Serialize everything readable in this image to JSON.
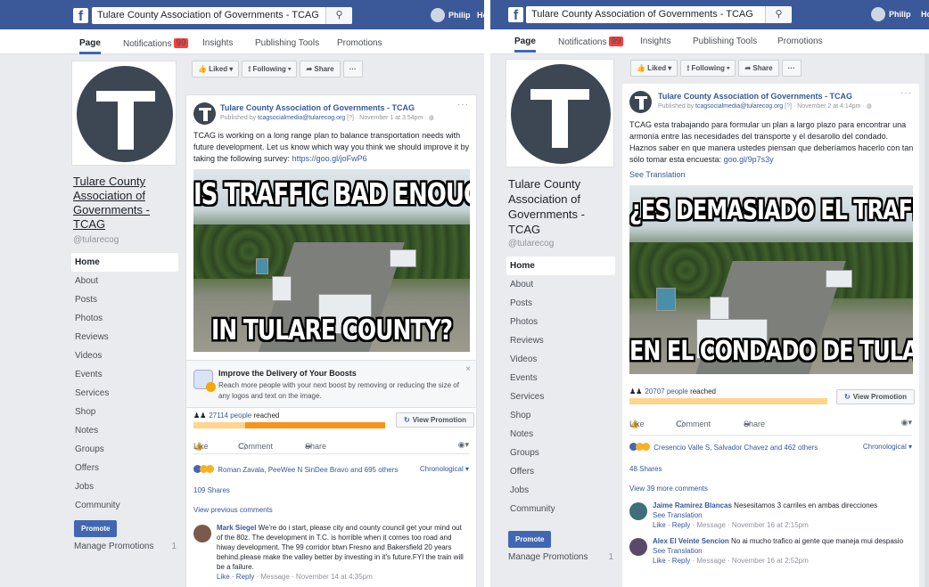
{
  "left": {
    "topbar": {
      "search": "Tulare County Association of Governments - TCAG",
      "search_icon": "search-icon",
      "user": "Philip",
      "extra": "Ho"
    },
    "subnav": {
      "page": "Page",
      "notifications": "Notifications",
      "notif_badge": "99",
      "insights": "Insights",
      "publishing": "Publishing Tools",
      "promotions": "Promotions"
    },
    "profile": {
      "name": "Tulare County Association of Governments - TCAG",
      "handle": "@tularecog"
    },
    "nav": [
      "Home",
      "About",
      "Posts",
      "Photos",
      "Reviews",
      "Videos",
      "Events",
      "Services",
      "Shop",
      "Notes",
      "Groups",
      "Offers",
      "Jobs",
      "Community"
    ],
    "promote": "Promote",
    "manage": "Manage Promotions",
    "manage_count": "1",
    "actions": {
      "liked": "👍 Liked ▾",
      "following": "⟟ Following ▾",
      "share": "➦ Share",
      "more": "···"
    },
    "post": {
      "title": "Tulare County Association of Governments - TCAG",
      "meta_prefix": "Published by ",
      "meta_email": "tcagsocialmedia@tularecog.org",
      "meta_suffix": " [?] · November 1 at 3:54pm · ◍",
      "more": "···",
      "text": "TCAG is working on a long range plan to balance transportation needs with future development. Let us know which way you think we should improve it by taking the following survey: ",
      "link": "https://goo.gl/joFwP6",
      "meme_top": "IS TRAFFIC BAD ENOUGH",
      "meme_bottom": "IN TULARE COUNTY?",
      "boost_title": "Improve the Delivery of Your Boosts",
      "boost_text": "Reach more people with your next boost by removing or reducing the size of any logos and text on the image.",
      "boost_close": "×",
      "reach_num": "27114 people",
      "reach_label": " reached",
      "reach_fraction": 0.27,
      "view_promo": "View Promotion",
      "like": "Like",
      "comment": "Comment",
      "share": "Share",
      "reactors": "Roman Zavala, PeeWee N SinDee Bravo and 695 others",
      "chron": "Chronological ▾",
      "shares": "109 Shares",
      "view_prev": "View previous comments",
      "c1_name": "Mark Siegel",
      "c1_text": " We're do i start, please city and county council get your mind out of the 80z. The development in T.C. is horrible when it comes too road and hiway development. The 99 corridor btwn Fresno and Bakersfield 20 years behind.please make the valley better by investing in it's future.FYI the train will be a failure.",
      "c1_meta_links": "Like · Reply",
      "c1_meta": " · Message · November 14 at 4:35pm"
    }
  },
  "right": {
    "topbar": {
      "search": "Tulare County Association of Governments - TCAG",
      "search_icon": "search-icon",
      "user": "Philip",
      "extra": "Ho"
    },
    "subnav": {
      "page": "Page",
      "notifications": "Notifications",
      "notif_badge": "99",
      "insights": "Insights",
      "publishing": "Publishing Tools",
      "promotions": "Promotions"
    },
    "profile": {
      "name": "Tulare County Association of Governments - TCAG",
      "handle": "@tularecog"
    },
    "nav": [
      "Home",
      "About",
      "Posts",
      "Photos",
      "Reviews",
      "Videos",
      "Events",
      "Services",
      "Shop",
      "Notes",
      "Groups",
      "Offers",
      "Jobs",
      "Community"
    ],
    "promote": "Promote",
    "manage": "Manage Promotions",
    "manage_count": "1",
    "actions": {
      "liked": "👍 Liked ▾",
      "following": "⟟ Following ▾",
      "share": "➦ Share",
      "more": "···"
    },
    "post": {
      "title": "Tulare County Association of Governments - TCAG",
      "meta_prefix": "Published by ",
      "meta_email": "tcagsocialmedia@tularecog.org",
      "meta_suffix": " [?] · November 2 at 4:14pm · ◍",
      "more": "···",
      "text": "TCAG esta trabajando para formular un plan a largo plazo para encontrar una armonía entre las necesidades del transporte y el desarollo del condado. Haznos saber en que manera ustedes piensan que deberíamos hacerlo con tan sólo tomar esta encuesta: ",
      "link": "goo.gl/9p7s3y",
      "see_translation": "See Translation",
      "meme_top": "¿ES DEMASIADO EL TRAFICO",
      "meme_bottom": "EN EL CONDADO DE TULARE?",
      "reach_num": "20707 people",
      "reach_label": " reached",
      "reach_fraction": 1.0,
      "view_promo": "View Promotion",
      "like": "Like",
      "comment": "Comment",
      "share": "Share",
      "reactors": "Cresencio Valle S, Salvador Chavez and 462 others",
      "chron": "Chronological ▾",
      "shares": "48 Shares",
      "view_more": "View 39 more comments",
      "c1_name": "Jaime Ramirez Blancas",
      "c1_text": " Nesesitamos 3 carriles en ambas direcciones",
      "c1_see": "See Translation",
      "c1_meta_links": "Like · Reply",
      "c1_meta": " · Message · November 16 at 2:15pm",
      "c2_name": "Alex El Veinte Sencion",
      "c2_text": " No ai mucho trafico ai gente que maneja mui despasio",
      "c2_see": "See Translation",
      "c2_meta_links": "Like · Reply",
      "c2_meta": " · Message · November 16 at 2:52pm"
    }
  },
  "colors": {
    "fb_blue": "#3b5998",
    "link": "#365899",
    "bar_orange": "#f7931e",
    "badge_red": "#fa3e3e"
  }
}
